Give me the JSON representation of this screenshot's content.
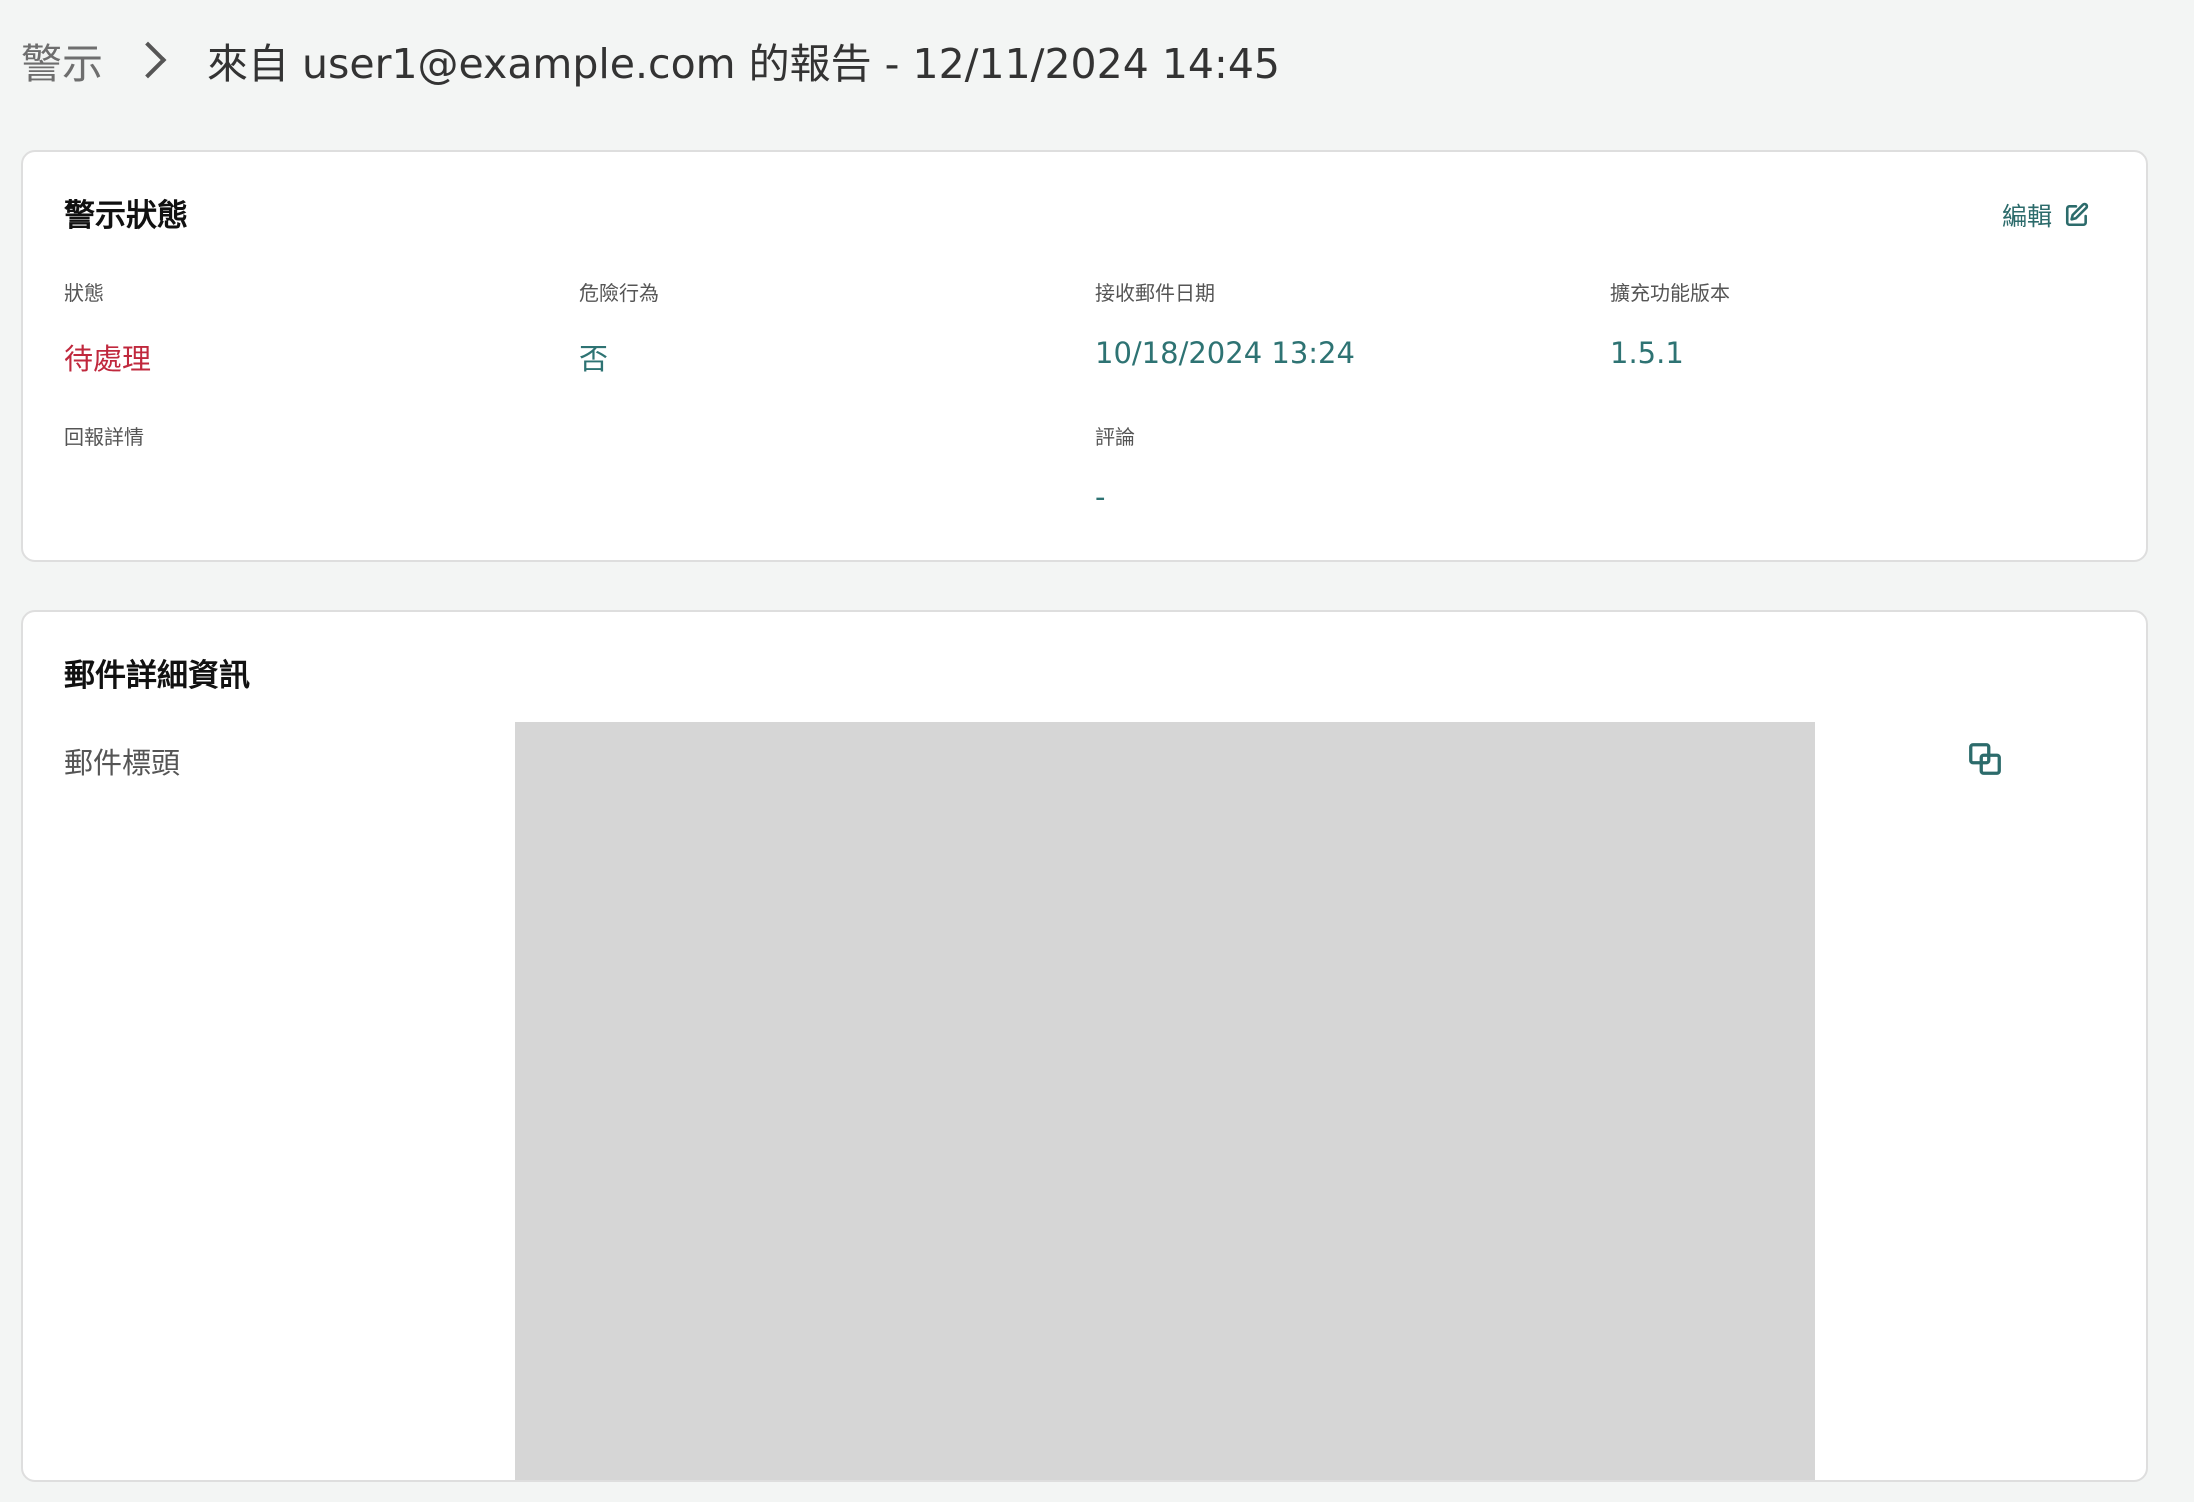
{
  "breadcrumb": {
    "root": "警示",
    "current": "來自 user1@example.com 的報告 - 12/11/2024 14:45"
  },
  "alert_status": {
    "title": "警示狀態",
    "edit_label": "編輯",
    "fields": {
      "status": {
        "label": "狀態",
        "value": "待處理"
      },
      "risky_behavior": {
        "label": "危險行為",
        "value": "否"
      },
      "received_date": {
        "label": "接收郵件日期",
        "value": "10/18/2024 13:24"
      },
      "extension_version": {
        "label": "擴充功能版本",
        "value": "1.5.1"
      },
      "report_details": {
        "label": "回報詳情",
        "value": ""
      },
      "comment": {
        "label": "評論",
        "value": "-"
      }
    }
  },
  "mail_details": {
    "title": "郵件詳細資訊",
    "headers_label": "郵件標頭"
  },
  "icons": {
    "breadcrumb_separator": "chevron-right-icon",
    "edit": "edit-icon",
    "copy": "copy-icon"
  },
  "colors": {
    "accent_teal": "#2e7373",
    "status_red": "#c0283d",
    "redacted_gray": "#d6d6d6"
  }
}
